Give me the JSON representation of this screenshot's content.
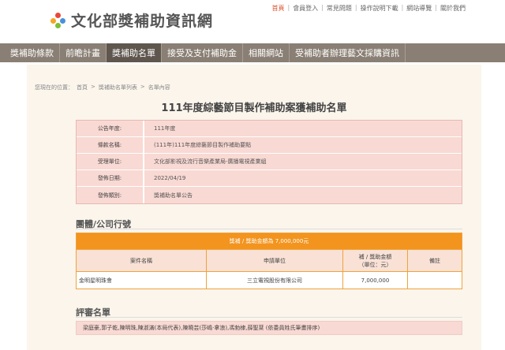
{
  "header": {
    "site_title": "文化部獎補助資訊網",
    "top_links": [
      "首頁",
      "會員登入",
      "常見問題",
      "操作說明下載",
      "網站導覽",
      "關於我們"
    ]
  },
  "nav": {
    "items": [
      "獎補助條款",
      "前瞻計畫",
      "獎補助名單",
      "接受及支付補助金",
      "相關網站",
      "受補助者辦理藝文採購資訊"
    ],
    "active_index": 2
  },
  "breadcrumb": {
    "prefix": "您現在的位置：",
    "items": [
      "首頁",
      "獎補助名單列表",
      "名單內容"
    ],
    "separator": ">"
  },
  "page_title": "111年度綜藝節目製作補助案獲補助名單",
  "info": [
    {
      "label": "公告年度:",
      "value": "111年度"
    },
    {
      "label": "條款名稱:",
      "value": "(111年)111年度綜藝節目製作補助要點"
    },
    {
      "label": "受理單位:",
      "value": "文化部影視及流行音樂產業局-廣播電視產業組"
    },
    {
      "label": "發佈日期:",
      "value": "2022/04/19"
    },
    {
      "label": "發佈類別:",
      "value": "獎補助名單公告"
    }
  ],
  "group_section": {
    "title": "團體/公司行號",
    "total_label": "獎補 / 獎助金額為 7,000,000元",
    "headers": [
      "案件名稱",
      "申請單位",
      "補 / 獎助金額\n（單位：元）",
      "備註"
    ],
    "rows": [
      [
        "金明星明珠會",
        "三立電視股份有限公司",
        "7,000,000",
        ""
      ]
    ]
  },
  "review_section": {
    "title": "評審名單",
    "members": "梁庭豪,郭子乾,陳明珠,陳淑滿(本局代表),陳曉芸(莎嶋‧拿浪),馮勃棣,薛聖棻 (依委員姓氏筆畫排序)"
  },
  "colors": {
    "nav_bg": "#8a7f74",
    "nav_active": "#5f564e",
    "panel_bg": "#fbf5ec",
    "info_row_bg": "#f9d9d3",
    "grant_orange": "#f2941e"
  }
}
